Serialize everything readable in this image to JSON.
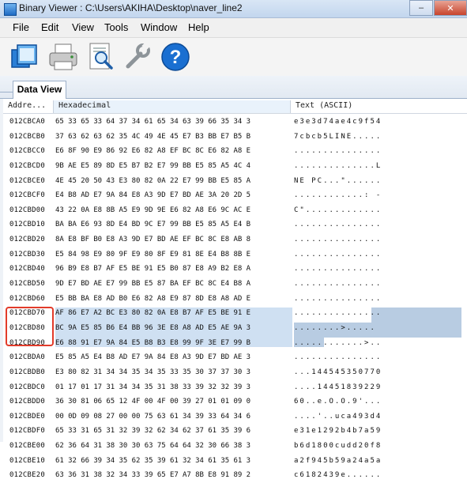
{
  "window": {
    "title": "Binary Viewer : C:\\Users\\AKIHA\\Desktop\\naver_line2",
    "minimize": "–",
    "close": "✕"
  },
  "menu": [
    "File",
    "Edit",
    "View",
    "Tools",
    "Window",
    "Help"
  ],
  "toolbar": [
    "open-icon",
    "print-icon",
    "inspect-icon",
    "tools-wrench-icon",
    "help-icon"
  ],
  "tabs": [
    "Data View"
  ],
  "columns": {
    "address": "Addre...",
    "hex": "Hexadecimal",
    "text": "Text (ASCII)"
  },
  "colors": {
    "selection": "#cfe0f2",
    "selection_text": "#b8cce2",
    "highlight_box": "#e23b2a"
  },
  "rows": [
    {
      "addr": "012CBCA0",
      "hex": "65 33 65 33 64 37 34 61 65 34 63 39 66 35 34 3",
      "text": "e3e3d74ae4c9f54"
    },
    {
      "addr": "012CBCB0",
      "hex": "37 63 62 63 62 35 4C 49 4E 45 E7 B3 BB E7 B5 B",
      "text": "7cbcb5LINE....."
    },
    {
      "addr": "012CBCC0",
      "hex": "E6 8F 90 E9 86 92 E6 82 A8 EF BC 8C E6 82 A8 E",
      "text": "..............."
    },
    {
      "addr": "012CBCD0",
      "hex": "9B AE E5 89 8D E5 B7 B2 E7 99 BB E5 85 A5 4C 4",
      "text": "..............L"
    },
    {
      "addr": "012CBCE0",
      "hex": "4E 45 20 50 43 E3 80 82 0A 22 E7 99 BB E5 85 A",
      "text": "NE PC...\"......"
    },
    {
      "addr": "012CBCF0",
      "hex": "E4 B8 AD E7 9A 84 E8 A3 9D E7 BD AE 3A 20 2D 5",
      "text": "............: -"
    },
    {
      "addr": "012CBD00",
      "hex": "43 22 0A E8 8B A5 E9 9D 9E E6 82 A8 E6 9C AC E",
      "text": "C\"............."
    },
    {
      "addr": "012CBD10",
      "hex": "BA BA E6 93 8D E4 BD 9C E7 99 BB E5 85 A5 E4 B",
      "text": "..............."
    },
    {
      "addr": "012CBD20",
      "hex": "8A E8 BF B0 E8 A3 9D E7 BD AE EF BC 8C E8 AB 8",
      "text": "..............."
    },
    {
      "addr": "012CBD30",
      "hex": "E5 84 98 E9 80 9F E9 80 8F E9 81 8E E4 B8 8B E",
      "text": "..............."
    },
    {
      "addr": "012CBD40",
      "hex": "96 B9 E8 B7 AF E5 BE 91 E5 B0 87 E8 A9 B2 E8 A",
      "text": "..............."
    },
    {
      "addr": "012CBD50",
      "hex": "9D E7 BD AE E7 99 BB E5 87 BA EF BC 8C E4 B8 A",
      "text": "..............."
    },
    {
      "addr": "012CBD60",
      "hex": "E5 BB BA E8 AD B0 E6 82 A8 E9 87 8D E8 A8 AD E",
      "text": "..............."
    },
    {
      "addr": "012CBD70",
      "hex": "AF 86 E7 A2 BC E3 80 82 0A E8 B7 AF E5 BE 91 E",
      "text": "..............."
    },
    {
      "addr": "012CBD80",
      "hex": "BC 9A E5 85 B6 E4 BB 96 3E E8 A8 AD E5 AE 9A 3",
      "text": "........>.....  "
    },
    {
      "addr": "012CBD90",
      "hex": "E6 88 91 E7 9A 84 E5 B8 B3 E8 99 9F 3E E7 99 B",
      "text": "............>.."
    },
    {
      "addr": "012CBDA0",
      "hex": "E5 85 A5 E4 B8 AD E7 9A 84 E8 A3 9D E7 BD AE 3",
      "text": "..............."
    },
    {
      "addr": "012CBDB0",
      "hex": "E3 80 82 31 34 34 35 34 35 33 35 30 37 37 30 3",
      "text": "...144545350770"
    },
    {
      "addr": "012CBDC0",
      "hex": "01 17 01 17 31 34 34 35 31 38 33 39 32 32 39 3",
      "text": "....14451839229"
    },
    {
      "addr": "012CBDD0",
      "hex": "36 30 81 06 65 12 4F 00 4F 00 39 27 01 01 09 0",
      "text": "60..e.O.O.9'..."
    },
    {
      "addr": "012CBDE0",
      "hex": "00 0D 09 08 27 00 00 75 63 61 34 39 33 64 34 6",
      "text": "....'..uca493d4"
    },
    {
      "addr": "012CBDF0",
      "hex": "65 33 31 65 31 32 39 32 62 34 62 37 61 35 39 6",
      "text": "e31e1292b4b7a59"
    },
    {
      "addr": "012CBE00",
      "hex": "62 36 64 31 38 30 30 63 75 64 64 32 30 66 38 3",
      "text": "b6d1800cudd20f8"
    },
    {
      "addr": "012CBE10",
      "hex": "61 32 66 39 34 35 62 35 39 61 32 34 61 35 61 3",
      "text": "a2f945b59a24a5a"
    },
    {
      "addr": "012CBE20",
      "hex": "63 36 31 38 32 34 33 39 65 E7 A7 8B E8 91 89 2",
      "text": "c6182439e......"
    }
  ]
}
